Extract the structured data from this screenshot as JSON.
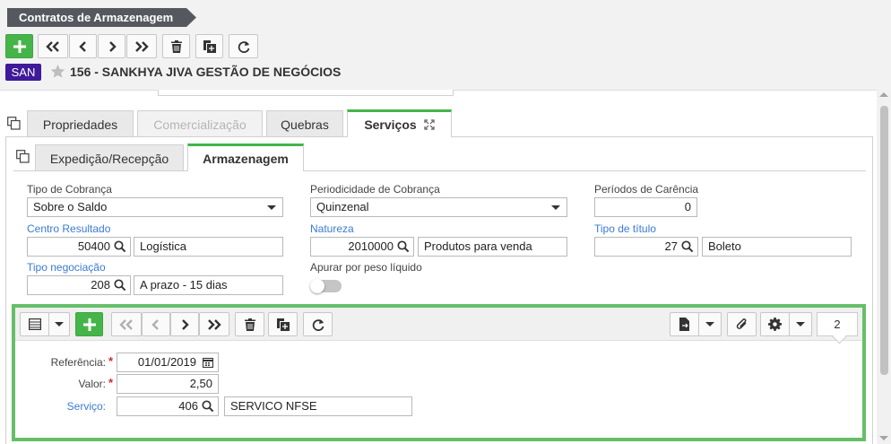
{
  "window": {
    "title": "Contratos de Armazenagem"
  },
  "header": {
    "company_badge": "SAN",
    "company_name": "156 - SANKHYA JIVA GESTÃO DE NEGÓCIOS"
  },
  "tabs": [
    "Propriedades",
    "Comercialização",
    "Quebras",
    "Serviços"
  ],
  "subtabs": [
    "Expedição/Recepção",
    "Armazenagem"
  ],
  "form": {
    "tipo_cobranca": {
      "label": "Tipo de Cobrança",
      "value": "Sobre o Saldo"
    },
    "periodicidade": {
      "label": "Periodicidade de Cobrança",
      "value": "Quinzenal"
    },
    "periodos_carencia": {
      "label": "Períodos de Carência",
      "value": "0"
    },
    "centro_resultado": {
      "label": "Centro Resultado",
      "code": "50400",
      "desc": "Logística"
    },
    "natureza": {
      "label": "Natureza",
      "code": "2010000",
      "desc": "Produtos para venda"
    },
    "tipo_titulo": {
      "label": "Tipo de título",
      "code": "27",
      "desc": "Boleto"
    },
    "tipo_negociacao": {
      "label": "Tipo negociação",
      "code": "208",
      "desc": "A prazo - 15 dias"
    },
    "apurar_peso": {
      "label": "Apurar por peso líquido",
      "value": false
    }
  },
  "grid": {
    "record_count": "2",
    "referencia": {
      "label": "Referência:",
      "value": "01/01/2019"
    },
    "valor": {
      "label": "Valor:",
      "value": "2,50"
    },
    "servico": {
      "label": "Serviço:",
      "code": "406",
      "desc": "SERVICO NFSE"
    }
  },
  "colors": {
    "accent_green": "#45b549",
    "title_bg": "#55595f",
    "badge": "#3f1a9a",
    "link": "#3a7bd5"
  }
}
